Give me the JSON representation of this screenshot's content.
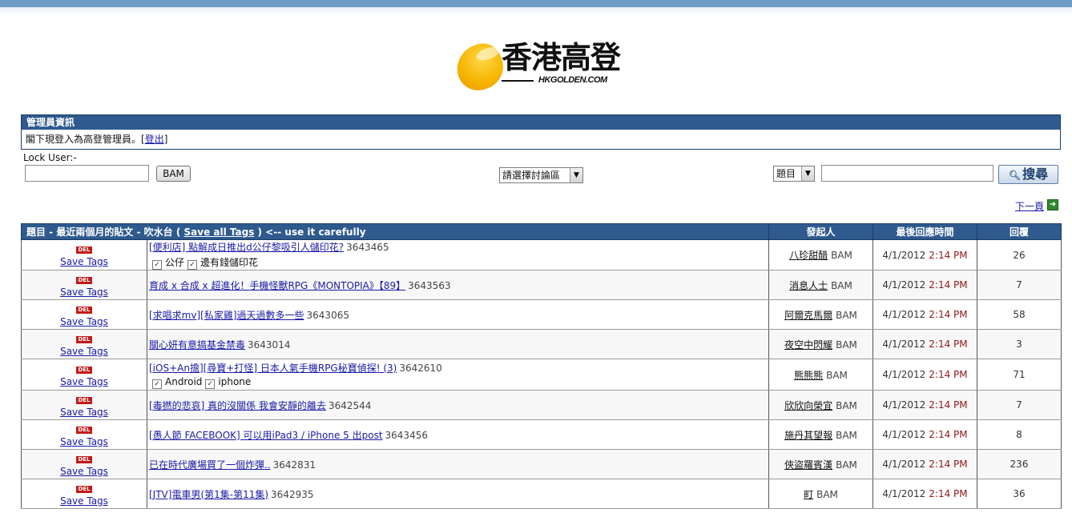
{
  "colors": {
    "header_bar": "#2e5a8e",
    "top_strip": "#6f9cc4",
    "link": "#1a1aa6",
    "time_highlight": "#8b1a1a",
    "del_badge": "#c51818"
  },
  "logo": {
    "chinese": "香港高登",
    "english": "HKGOLDEN.COM"
  },
  "admin": {
    "title": "管理員資訊",
    "message": "閣下現登入為高登管理員。",
    "logout_open": "[",
    "logout_label": "登出",
    "logout_close": "]"
  },
  "controls": {
    "lock_label": "Lock User:-",
    "lock_value": "",
    "bam_label": "BAM",
    "forum_select": "請選擇討論區",
    "search_type": "題目",
    "search_value": "",
    "search_button": "搜尋",
    "search_icon": "magnifier-icon",
    "next_page": "下一頁",
    "next_icon": "arrow-right-icon"
  },
  "table": {
    "header_title_prefix": "題目 - 最近兩個月的貼文 - 吹水台 ( ",
    "header_save_all": "Save all Tags",
    "header_title_suffix": " ) <-- use it carefully",
    "col_author": "發起人",
    "col_last_reply": "最後回應時間",
    "col_replies": "回覆",
    "del_label": "DEL",
    "save_tags_label": "Save Tags",
    "bam_tag": "BAM",
    "rows": [
      {
        "title": "[便利店] 點解成日推出d公仔黎吸引人儲印花?",
        "id": "3643465",
        "tags": [
          "公仔",
          "邊有錢儲印花"
        ],
        "author": "八珍甜醋",
        "date": "4/1/2012",
        "time": "2:14 PM",
        "replies": "26"
      },
      {
        "title": "育成 x 合成 x 超進化！手機怪獸RPG《MONTOPIA》【89】",
        "id": "3643563",
        "tags": [],
        "author": "消息人士",
        "date": "4/1/2012",
        "time": "2:14 PM",
        "replies": "7"
      },
      {
        "title": "[求唱求mv][私家雞]過天過數多一些",
        "id": "3643065",
        "tags": [],
        "author": "阿爾克馬爾",
        "date": "4/1/2012",
        "time": "2:14 PM",
        "replies": "58"
      },
      {
        "title": "關心妍有意搞基金禁毒",
        "id": "3643014",
        "tags": [],
        "author": "夜空中閃耀",
        "date": "4/1/2012",
        "time": "2:14 PM",
        "replies": "3"
      },
      {
        "title": "[iOS+An擔][尋寶+打怪] 日本人氣手機RPG秘寶偵探! (3)",
        "id": "3642610",
        "tags": [
          "Android",
          "iphone"
        ],
        "author": "熊熊熊",
        "date": "4/1/2012",
        "time": "2:14 PM",
        "replies": "71"
      },
      {
        "title": "[毒撚的悲哀] 真的沒關係   我會安靜的離去",
        "id": "3642544",
        "tags": [],
        "author": "欣欣向榮宜",
        "date": "4/1/2012",
        "time": "2:14 PM",
        "replies": "7"
      },
      {
        "title": "[愚人節 FACEBOOK] 可以用iPad3 / iPhone 5 出post",
        "id": "3643456",
        "tags": [],
        "author": "施丹其望報",
        "date": "4/1/2012",
        "time": "2:14 PM",
        "replies": "8"
      },
      {
        "title": "已在時代廣場買了一個炸彈..",
        "id": "3642831",
        "tags": [],
        "author": "俠盜羅賓漢",
        "date": "4/1/2012",
        "time": "2:14 PM",
        "replies": "236"
      },
      {
        "title": "[JTV]電車男(第1集-第11集)",
        "id": "3642935",
        "tags": [],
        "author": "町",
        "date": "4/1/2012",
        "time": "2:14 PM",
        "replies": "36"
      }
    ]
  }
}
